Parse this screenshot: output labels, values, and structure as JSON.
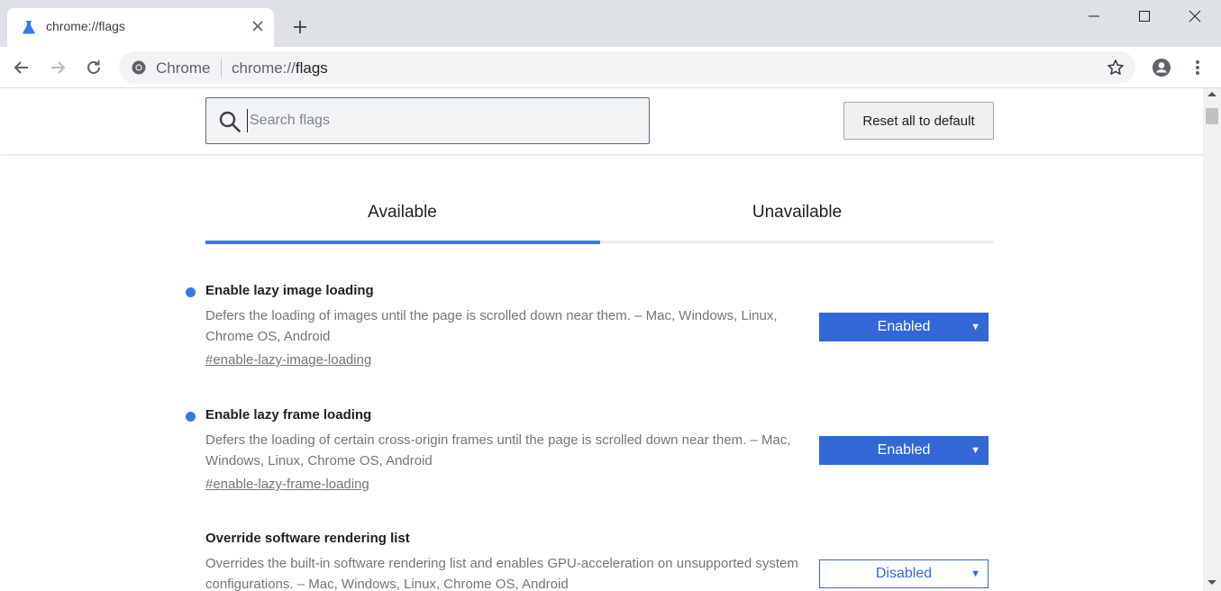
{
  "browser": {
    "tab": {
      "title": "chrome://flags",
      "favicon": "flask-icon"
    },
    "omnibox": {
      "chip": "Chrome",
      "url_prefix": "chrome://",
      "url_host": "flags"
    }
  },
  "header": {
    "search": {
      "placeholder": "Search flags",
      "value": ""
    },
    "reset_label": "Reset all to default"
  },
  "tabs": [
    {
      "label": "Available",
      "active": true
    },
    {
      "label": "Unavailable",
      "active": false
    }
  ],
  "experiments": [
    {
      "title": "Enable lazy image loading",
      "desc": "Defers the loading of images until the page is scrolled down near them. – Mac, Windows, Linux, Chrome OS, Android",
      "link": "#enable-lazy-image-loading",
      "value": "Enabled",
      "modified": true
    },
    {
      "title": "Enable lazy frame loading",
      "desc": "Defers the loading of certain cross-origin frames until the page is scrolled down near them. – Mac, Windows, Linux, Chrome OS, Android",
      "link": "#enable-lazy-frame-loading",
      "value": "Enabled",
      "modified": true
    },
    {
      "title": "Override software rendering list",
      "desc": "Overrides the built-in software rendering list and enables GPU-acceleration on unsupported system configurations. – Mac, Windows, Linux, Chrome OS, Android",
      "link": "",
      "value": "Disabled",
      "modified": false
    }
  ],
  "colors": {
    "accent": "#3b78e7",
    "select_blue": "#3367d6",
    "tabstrip": "#dee1e6"
  }
}
